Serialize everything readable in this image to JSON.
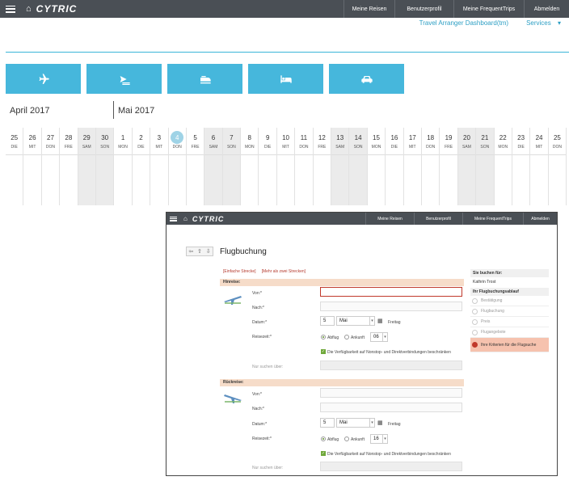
{
  "app": {
    "logo": "CYTRIC",
    "menu": [
      "Meine Reisen",
      "Benutzerprofil",
      "Meine FrequentTrips",
      "Abmelden"
    ]
  },
  "subnav": {
    "dashboard": "Travel Arranger Dashboard(tm)",
    "services": "Services"
  },
  "modes": [
    {
      "name": "flight-icon"
    },
    {
      "name": "rail-flight-icon"
    },
    {
      "name": "train-icon"
    },
    {
      "name": "hotel-icon"
    },
    {
      "name": "car-icon"
    }
  ],
  "calendar": {
    "month1": "April 2017",
    "month2": "Mai 2017",
    "days": [
      {
        "n": "25",
        "w": "DIE"
      },
      {
        "n": "26",
        "w": "MIT"
      },
      {
        "n": "27",
        "w": "DON"
      },
      {
        "n": "28",
        "w": "FRE"
      },
      {
        "n": "29",
        "w": "SAM",
        "we": true
      },
      {
        "n": "30",
        "w": "SON",
        "we": true
      },
      {
        "n": "1",
        "w": "MON"
      },
      {
        "n": "2",
        "w": "DIE"
      },
      {
        "n": "3",
        "w": "MIT"
      },
      {
        "n": "4",
        "w": "DON",
        "today": true
      },
      {
        "n": "5",
        "w": "FRE"
      },
      {
        "n": "6",
        "w": "SAM",
        "we": true
      },
      {
        "n": "7",
        "w": "SON",
        "we": true
      },
      {
        "n": "8",
        "w": "MON"
      },
      {
        "n": "9",
        "w": "DIE"
      },
      {
        "n": "10",
        "w": "MIT"
      },
      {
        "n": "11",
        "w": "DON"
      },
      {
        "n": "12",
        "w": "FRE"
      },
      {
        "n": "13",
        "w": "SAM",
        "we": true
      },
      {
        "n": "14",
        "w": "SON",
        "we": true
      },
      {
        "n": "15",
        "w": "MON"
      },
      {
        "n": "16",
        "w": "DIE"
      },
      {
        "n": "17",
        "w": "MIT"
      },
      {
        "n": "18",
        "w": "DON"
      },
      {
        "n": "19",
        "w": "FRE"
      },
      {
        "n": "20",
        "w": "SAM",
        "we": true
      },
      {
        "n": "21",
        "w": "SON",
        "we": true
      },
      {
        "n": "22",
        "w": "MON"
      },
      {
        "n": "23",
        "w": "DIE"
      },
      {
        "n": "24",
        "w": "MIT"
      },
      {
        "n": "25",
        "w": "DON"
      }
    ]
  },
  "win": {
    "title": "Flugbuchung",
    "links": [
      "[Einfache Strecke]",
      "[Mehr als zwei Strecken]"
    ],
    "hin": {
      "header": "Hinreise:",
      "von": "Von:*",
      "nach": "Nach:*",
      "datum": "Datum:*",
      "day": "5",
      "month": "Mai",
      "weekday": "Freitag",
      "reisezeit": "Reisezeit:*",
      "abflug": "Abflug",
      "ankunft": "Ankunft",
      "hour": "06",
      "check": "Die Verfügbarkeit auf Nonstop- und Direktverbindungen beschränken",
      "nur": "Nur suchen über:"
    },
    "rueck": {
      "header": "Rückreise:",
      "von": "Von:*",
      "nach": "Nach:*",
      "datum": "Datum:*",
      "day": "5",
      "month": "Mai",
      "weekday": "Freitag",
      "reisezeit": "Reisezeit:*",
      "abflug": "Abflug",
      "ankunft": "Ankunft",
      "hour": "16",
      "check": "Die Verfügbarkeit auf Nonstop- und Direktverbindungen beschränken",
      "nur": "Nur suchen über:"
    },
    "side": {
      "for_label": "Sie buchen für:",
      "for_name": "Kathrin Trost",
      "flow_label": "Ihr Flugbuchungsablauf",
      "steps": [
        "Bestätigung",
        "Flugbuchung",
        "Preis",
        "Flugangebote",
        "Ihre Kriterien für die Flugsuche"
      ]
    }
  }
}
